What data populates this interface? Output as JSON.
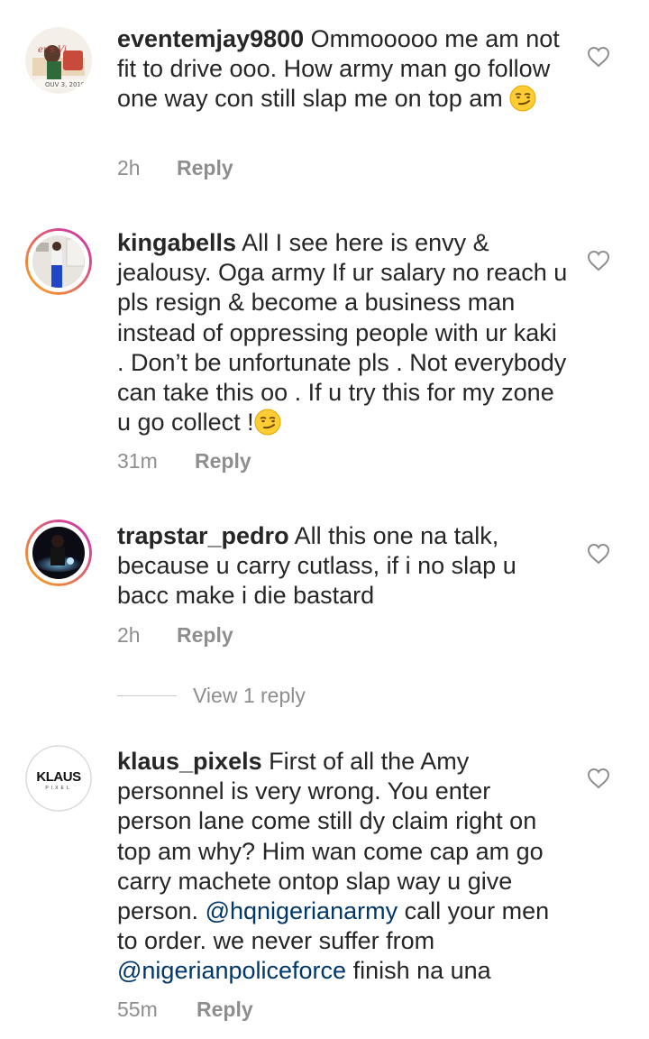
{
  "comments": [
    {
      "username": "eventemjay9800",
      "text": "Ommooooo me am not fit to drive ooo. How army man go follow one way con still slap me on top am",
      "emoji": "smirk-emoji",
      "time": "2h",
      "reply_label": "Reply"
    },
    {
      "username": "kingabells",
      "text": "All I see here is envy & jealousy. Oga army If ur salary no reach u pls resign & become a business man instead of oppressing people with ur kaki . Don’t be unfortunate pls . Not everybody can take this oo . If u try this for my zone u go collect !",
      "emoji": "smirk-emoji",
      "time": "31m",
      "reply_label": "Reply"
    },
    {
      "username": "trapstar_pedro",
      "text": "All this one na talk, because u carry cutlass, if i no slap u bacc make i die bastard",
      "time": "2h",
      "reply_label": "Reply",
      "view_replies": "View 1 reply"
    },
    {
      "username": "klaus_pixels",
      "text_before": "First of all the Amy personnel is very wrong. You enter person lane come still dy claim right on top am why? Him wan come cap am go carry machete ontop slap way u give person.",
      "mention1": "@hqnigerianarmy",
      "text_middle": "call your men to order. we never suffer from",
      "mention2": "@nigerianpoliceforce",
      "text_after": "finish na  una",
      "avatar_logo": "KLAUS",
      "avatar_sub": "PIXEL",
      "time": "55m",
      "reply_label": "Reply"
    }
  ],
  "colors": {
    "text": "#262626",
    "meta": "#8e8e8e",
    "mention": "#00376b",
    "story_ring_start": "#f9a51a",
    "story_ring_end": "#c92bb7"
  },
  "icons": {
    "like": "heart-outline-icon"
  }
}
